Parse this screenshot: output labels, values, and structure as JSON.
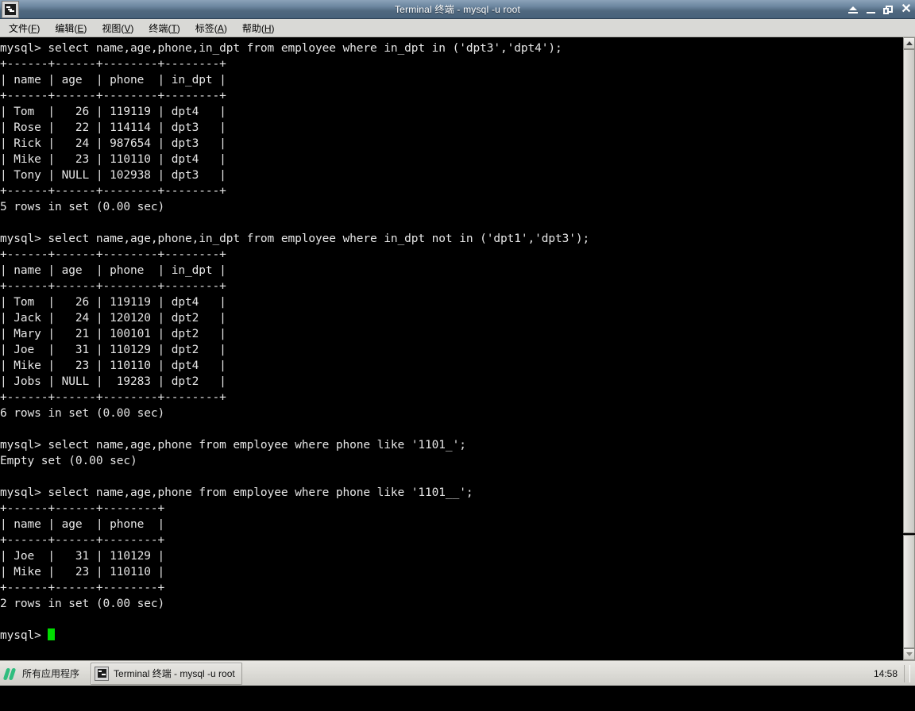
{
  "window": {
    "title": "Terminal 终端 - mysql -u root",
    "icon": "terminal-icon",
    "controls": {
      "shade_label": "▲",
      "minimize_label": "_",
      "maximize_label": "❐",
      "close_label": "✕"
    }
  },
  "menubar": {
    "items": [
      {
        "text": "文件",
        "accel": "F"
      },
      {
        "text": "编辑",
        "accel": "E"
      },
      {
        "text": "视图",
        "accel": "V"
      },
      {
        "text": "终端",
        "accel": "T"
      },
      {
        "text": "标签",
        "accel": "A"
      },
      {
        "text": "帮助",
        "accel": "H"
      }
    ]
  },
  "terminal": {
    "prompt": "mysql> ",
    "foreground": "#e6e6e6",
    "background": "#000000",
    "cursor_color": "#00dd00",
    "lines": [
      "mysql> select name,age,phone,in_dpt from employee where in_dpt in ('dpt3','dpt4');",
      "+------+------+--------+--------+",
      "| name | age  | phone  | in_dpt |",
      "+------+------+--------+--------+",
      "| Tom  |   26 | 119119 | dpt4   |",
      "| Rose |   22 | 114114 | dpt3   |",
      "| Rick |   24 | 987654 | dpt3   |",
      "| Mike |   23 | 110110 | dpt4   |",
      "| Tony | NULL | 102938 | dpt3   |",
      "+------+------+--------+--------+",
      "5 rows in set (0.00 sec)",
      "",
      "mysql> select name,age,phone,in_dpt from employee where in_dpt not in ('dpt1','dpt3');",
      "+------+------+--------+--------+",
      "| name | age  | phone  | in_dpt |",
      "+------+------+--------+--------+",
      "| Tom  |   26 | 119119 | dpt4   |",
      "| Jack |   24 | 120120 | dpt2   |",
      "| Mary |   21 | 100101 | dpt2   |",
      "| Joe  |   31 | 110129 | dpt2   |",
      "| Mike |   23 | 110110 | dpt4   |",
      "| Jobs | NULL |  19283 | dpt2   |",
      "+------+------+--------+--------+",
      "6 rows in set (0.00 sec)",
      "",
      "mysql> select name,age,phone from employee where phone like '1101_';",
      "Empty set (0.00 sec)",
      "",
      "mysql> select name,age,phone from employee where phone like '1101__';",
      "+------+------+--------+",
      "| name | age  | phone  |",
      "+------+------+--------+",
      "| Joe  |   31 | 110129 |",
      "| Mike |   23 | 110110 |",
      "+------+------+--------+",
      "2 rows in set (0.00 sec)",
      ""
    ],
    "last_prompt": "mysql> "
  },
  "taskbar": {
    "start_label": "所有应用程序",
    "window_button": "Terminal 终端 - mysql -u root",
    "clock": "14:58"
  }
}
